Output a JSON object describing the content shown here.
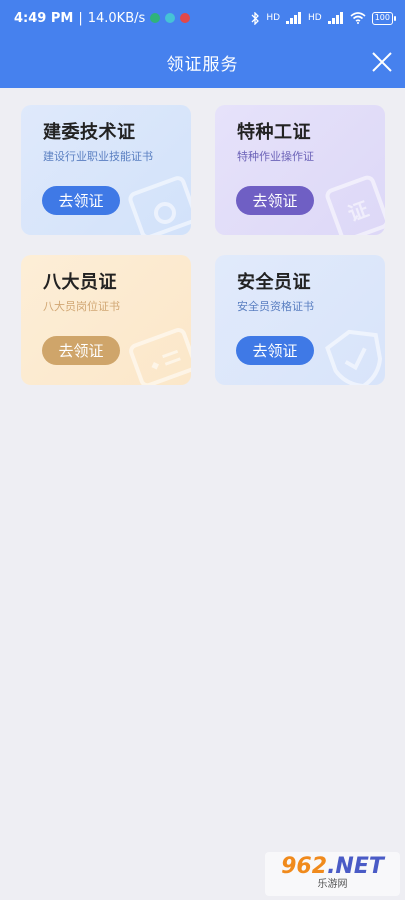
{
  "status_bar": {
    "time": "4:49 PM",
    "speed": "14.0KB/s",
    "battery": "100",
    "network_label": "HD"
  },
  "header": {
    "title": "领证服务"
  },
  "cards": [
    {
      "title": "建委技术证",
      "subtitle": "建设行业职业技能证书",
      "button": "去领证"
    },
    {
      "title": "特种工证",
      "subtitle": "特种作业操作证",
      "button": "去领证",
      "badge": "证"
    },
    {
      "title": "八大员证",
      "subtitle": "八大员岗位证书",
      "button": "去领证"
    },
    {
      "title": "安全员证",
      "subtitle": "安全员资格证书",
      "button": "去领证"
    }
  ],
  "watermark": {
    "brand": "962",
    "suffix": ".NET",
    "caption": "乐游网"
  },
  "colors": {
    "header_bg": "#4681ee",
    "page_bg": "#eeeef3",
    "blue_button": "#3f79e6",
    "purple_button": "#6f5fc4",
    "gold_button": "#cfa56a"
  }
}
